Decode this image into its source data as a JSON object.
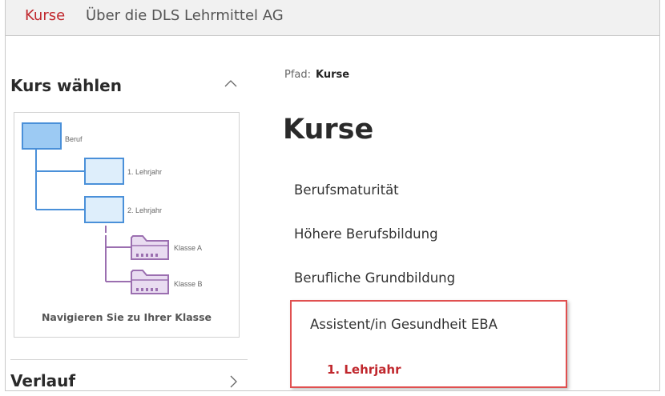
{
  "topnav": {
    "items": [
      {
        "label": "Kurse",
        "active": true
      },
      {
        "label": "Über die DLS Lehrmittel AG",
        "active": false
      }
    ]
  },
  "sidebar": {
    "title": "Kurs wählen",
    "diagram": {
      "nodes": [
        "Beruf",
        "1. Lehrjahr",
        "2. Lehrjahr",
        "Klasse A",
        "Klasse B"
      ],
      "caption": "Navigieren Sie zu Ihrer Klasse"
    },
    "verlauf_label": "Verlauf"
  },
  "main": {
    "breadcrumb": {
      "prefix": "Pfad:",
      "current": "Kurse"
    },
    "title": "Kurse",
    "items": [
      "Berufsmaturität",
      "Höhere Berufsbildung",
      "Berufliche Grundbildung",
      "Assistent/in Gesundheit EBA"
    ],
    "subitem": "1. Lehrjahr"
  },
  "colors": {
    "accent": "#c0272d",
    "highlight_border": "#e05050",
    "tree_blue": "#4a90d9",
    "tree_purple": "#9b6fb0"
  }
}
